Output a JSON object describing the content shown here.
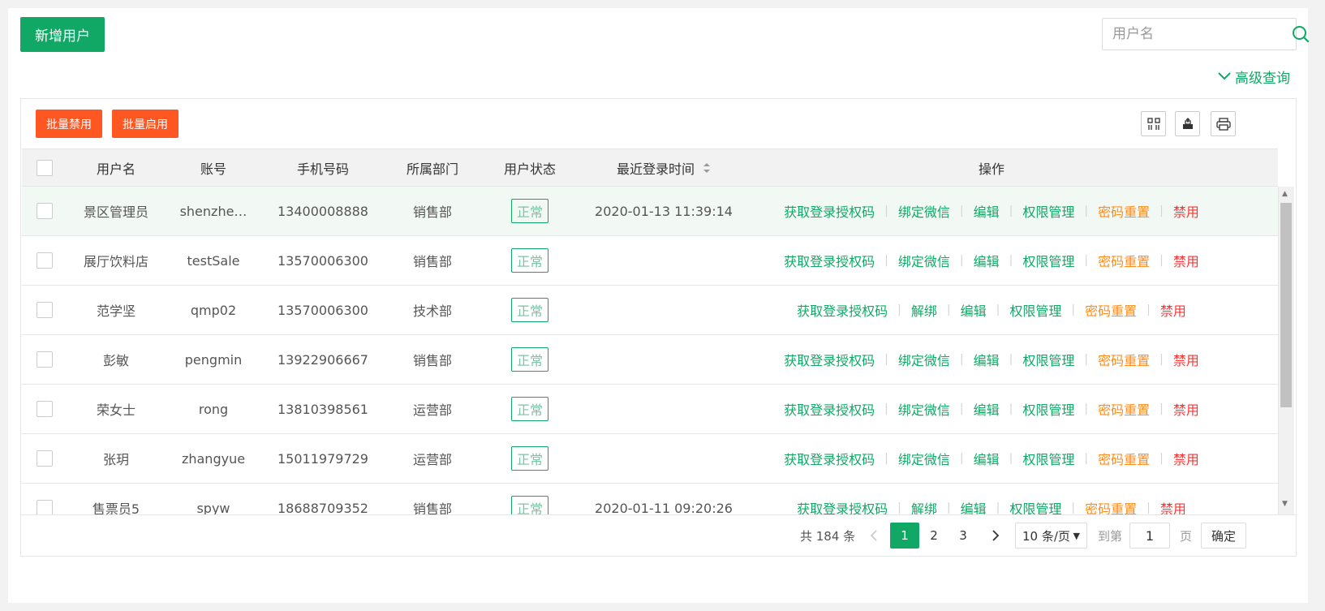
{
  "header": {
    "add_user_label": "新增用户",
    "search_placeholder": "用户名",
    "advanced_search_label": "高级查询"
  },
  "toolbar": {
    "batch_disable_label": "批量禁用",
    "batch_enable_label": "批量启用",
    "icons": [
      "filter-columns-icon",
      "export-icon",
      "print-icon"
    ]
  },
  "table": {
    "columns": {
      "username": "用户名",
      "account": "账号",
      "phone": "手机号码",
      "department": "所属部门",
      "status": "用户状态",
      "last_login": "最近登录时间",
      "actions": "操作"
    },
    "rows": [
      {
        "username": "景区管理员",
        "account": "shenzhe…",
        "phone": "13400008888",
        "department": "销售部",
        "status": "正常",
        "last_login": "2020-01-13 11:39:14",
        "bind_label": "绑定微信"
      },
      {
        "username": "展厅饮料店",
        "account": "testSale",
        "phone": "13570006300",
        "department": "销售部",
        "status": "正常",
        "last_login": "",
        "bind_label": "绑定微信"
      },
      {
        "username": "范学坚",
        "account": "qmp02",
        "phone": "13570006300",
        "department": "技术部",
        "status": "正常",
        "last_login": "",
        "bind_label": "解绑"
      },
      {
        "username": "彭敏",
        "account": "pengmin",
        "phone": "13922906667",
        "department": "销售部",
        "status": "正常",
        "last_login": "",
        "bind_label": "绑定微信"
      },
      {
        "username": "荣女士",
        "account": "rong",
        "phone": "13810398561",
        "department": "运营部",
        "status": "正常",
        "last_login": "",
        "bind_label": "绑定微信"
      },
      {
        "username": "张玥",
        "account": "zhangyue",
        "phone": "15011979729",
        "department": "运营部",
        "status": "正常",
        "last_login": "",
        "bind_label": "绑定微信"
      },
      {
        "username": "售票员5",
        "account": "spyw",
        "phone": "18688709352",
        "department": "销售部",
        "status": "正常",
        "last_login": "2020-01-11 09:20:26",
        "bind_label": "解绑"
      }
    ],
    "actions": {
      "auth_code": "获取登录授权码",
      "edit": "编辑",
      "permissions": "权限管理",
      "reset_password": "密码重置",
      "disable": "禁用"
    }
  },
  "pagination": {
    "total_text": "共 184 条",
    "pages": [
      "1",
      "2",
      "3"
    ],
    "current_page": "1",
    "page_size": "10 条/页",
    "goto_label": "到第",
    "goto_value": "1",
    "page_unit": "页",
    "confirm_label": "确定"
  },
  "colors": {
    "primary": "#11a866",
    "danger_button": "#ff5722",
    "reset_password": "#ff8c1a",
    "disable": "#ff3333"
  }
}
